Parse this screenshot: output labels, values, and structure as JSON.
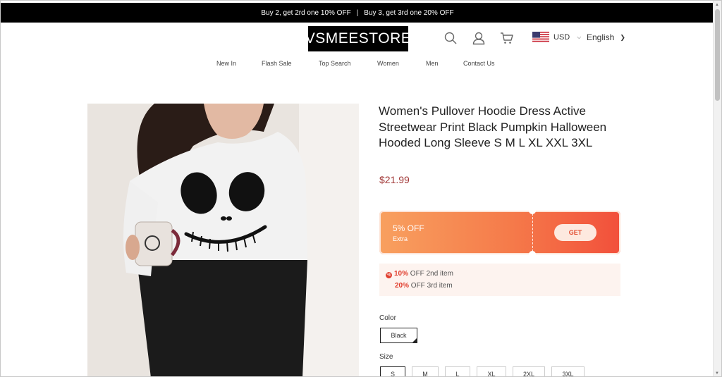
{
  "promo": {
    "offer1": "Buy 2, get 2rd one 10% OFF",
    "separator": "|",
    "offer2": "Buy 3, get 3rd one 20% OFF"
  },
  "header": {
    "logo": "VSMEESTORE",
    "currency": "USD",
    "language": "English",
    "icons": [
      "search-icon",
      "account-icon",
      "cart-icon",
      "us-flag-icon"
    ]
  },
  "nav": {
    "items": [
      "New In",
      "Flash Sale",
      "Top Search",
      "Women",
      "Men",
      "Contact Us"
    ]
  },
  "product": {
    "title": "Women's Pullover Hoodie Dress Active Streetwear Print Black Pumpkin Halloween Hooded Long Sleeve S M L XL XXL 3XL",
    "price": "$21.99",
    "coupon": {
      "percent": "5% OFF",
      "extra": "Extra",
      "get_label": "GET"
    },
    "deals": [
      {
        "bold": "10%",
        "text": " OFF 2nd item"
      },
      {
        "bold": "20%",
        "text": " OFF 3rd item"
      }
    ],
    "color_label": "Color",
    "color_selected": "Black",
    "size_label": "Size",
    "sizes": [
      "S",
      "M",
      "L",
      "XL",
      "2XL",
      "3XL"
    ],
    "size_selected": "S"
  },
  "colors": {
    "price": "#a23a39",
    "coupon_start": "#f8a05f",
    "coupon_end": "#f2503b",
    "deal_accent": "#e03c2c",
    "promo_bg": "#000000"
  }
}
